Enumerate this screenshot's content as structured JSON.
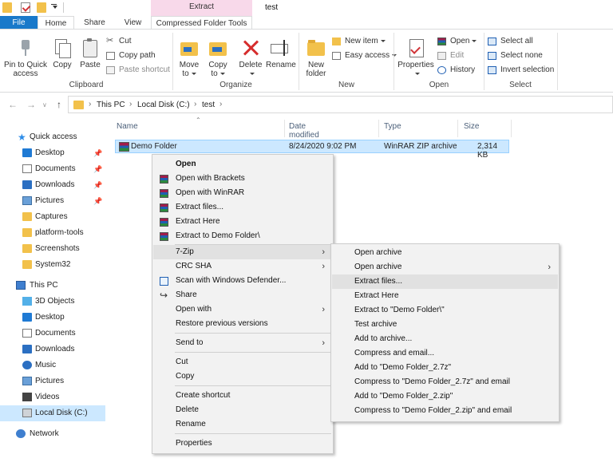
{
  "window": {
    "title": "test",
    "contextual_tab_group": "Extract"
  },
  "tabs": {
    "file": "File",
    "home": "Home",
    "share": "Share",
    "view": "View",
    "compressed_folder_tools": "Compressed Folder Tools"
  },
  "ribbon": {
    "clipboard": {
      "pin": "Pin to Quick\naccess",
      "copy": "Copy",
      "paste": "Paste",
      "cut": "Cut",
      "copy_path": "Copy path",
      "paste_shortcut": "Paste shortcut",
      "label": "Clipboard"
    },
    "organize": {
      "move_to_1": "Move",
      "move_to_2": "to",
      "copy_to_1": "Copy",
      "copy_to_2": "to",
      "delete": "Delete",
      "rename": "Rename",
      "label": "Organize"
    },
    "new": {
      "new_folder_1": "New",
      "new_folder_2": "folder",
      "new_item": "New item",
      "easy_access": "Easy access",
      "label": "New"
    },
    "open": {
      "properties": "Properties",
      "open": "Open",
      "edit": "Edit",
      "history": "History",
      "label": "Open"
    },
    "select": {
      "select_all": "Select all",
      "select_none": "Select none",
      "invert": "Invert selection",
      "label": "Select"
    }
  },
  "address": {
    "crumbs": [
      "This PC",
      "Local Disk (C:)",
      "test"
    ]
  },
  "nav_pane": {
    "quick_access": "Quick access",
    "quick_items": [
      "Desktop",
      "Documents",
      "Downloads",
      "Pictures",
      "Captures",
      "platform-tools",
      "Screenshots",
      "System32"
    ],
    "this_pc": "This PC",
    "pc_items": [
      "3D Objects",
      "Desktop",
      "Documents",
      "Downloads",
      "Music",
      "Pictures",
      "Videos",
      "Local Disk (C:)"
    ],
    "network": "Network",
    "selected": "Local Disk (C:)"
  },
  "file_list": {
    "columns": [
      "Name",
      "Date modified",
      "Type",
      "Size"
    ],
    "rows": [
      {
        "name": "Demo Folder",
        "date": "8/24/2020 9:02 PM",
        "type": "WinRAR ZIP archive",
        "size": "2,314 KB"
      }
    ]
  },
  "context_menu": {
    "items": [
      "Open",
      "Open with Brackets",
      "Open with WinRAR",
      "Extract files...",
      "Extract Here",
      "Extract to Demo Folder\\",
      "7-Zip",
      "CRC SHA",
      "Scan with Windows Defender...",
      "Share",
      "Open with",
      "Restore previous versions",
      "Send to",
      "Cut",
      "Copy",
      "Create shortcut",
      "Delete",
      "Rename",
      "Properties"
    ],
    "highlighted": "7-Zip"
  },
  "submenu_7zip": {
    "items": [
      "Open archive",
      "Open archive",
      "Extract files...",
      "Extract Here",
      "Extract to \"Demo Folder\\\"",
      "Test archive",
      "Add to archive...",
      "Compress and email...",
      "Add to \"Demo Folder_2.7z\"",
      "Compress to \"Demo Folder_2.7z\" and email",
      "Add to \"Demo Folder_2.zip\"",
      "Compress to \"Demo Folder_2.zip\" and email"
    ],
    "highlighted": "Extract files..."
  },
  "colors": {
    "accent": "#1979ca",
    "selection": "#cce8ff",
    "contextual_tab": "#f8d9ea",
    "menu_bg": "#f2f2f2"
  }
}
